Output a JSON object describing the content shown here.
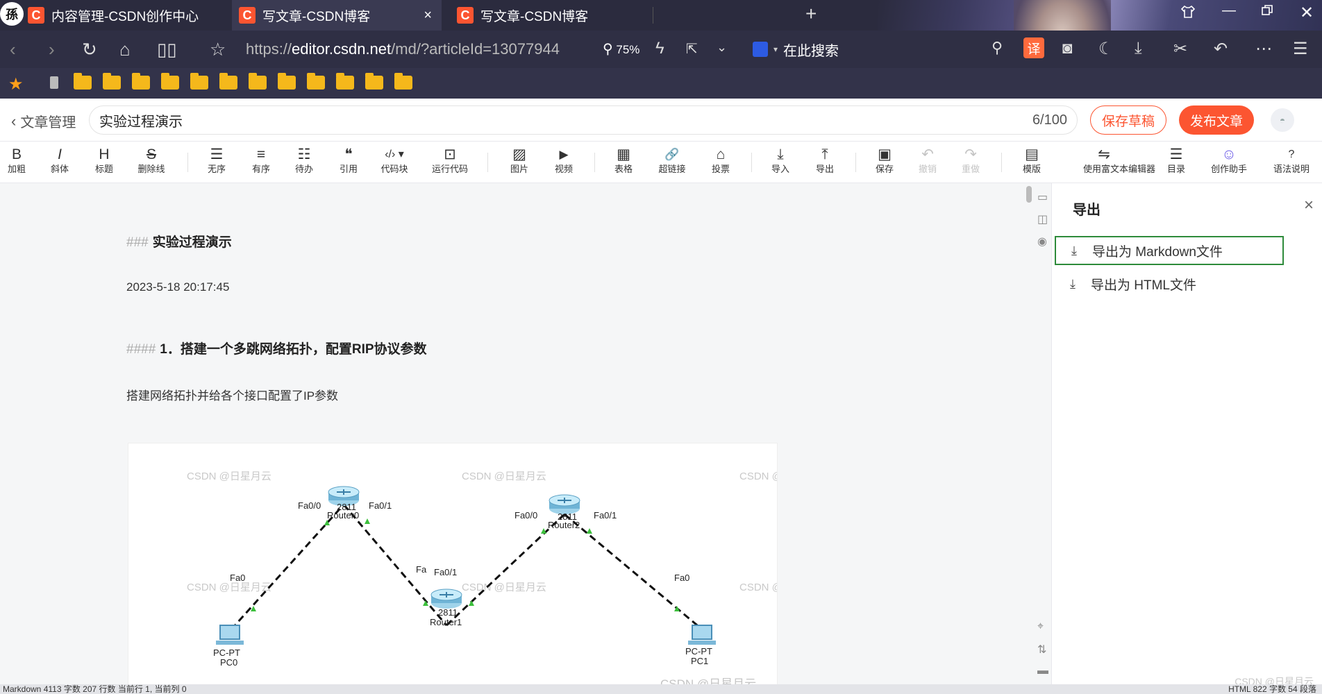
{
  "browser": {
    "app_logo": "孫",
    "tabs": [
      {
        "title": "内容管理-CSDN创作中心",
        "favicon": "C"
      },
      {
        "title": "写文章-CSDN博客",
        "favicon": "C",
        "close": "×"
      },
      {
        "title": "写文章-CSDN博客",
        "favicon": "C"
      }
    ],
    "url_prefix": "https://",
    "url_host": "editor.csdn.net",
    "url_path": "/md/?articleId=13077944",
    "zoom": "75%",
    "search_placeholder": "在此搜索",
    "translate_label": "译"
  },
  "editor": {
    "back_label": "文章管理",
    "title_value": "实验过程演示",
    "title_count": "6/100",
    "save_draft": "保存草稿",
    "publish": "发布文章"
  },
  "toolbar": [
    {
      "icon": "B",
      "label": "加粗"
    },
    {
      "icon": "I",
      "label": "斜体"
    },
    {
      "icon": "H",
      "label": "标题"
    },
    {
      "icon": "S",
      "label": "删除线"
    },
    {
      "icon": "☰",
      "label": "无序"
    },
    {
      "icon": "≡",
      "label": "有序"
    },
    {
      "icon": "☷",
      "label": "待办"
    },
    {
      "icon": "❝",
      "label": "引用"
    },
    {
      "icon": "‹/› ▾",
      "label": "代码块"
    },
    {
      "icon": "⊡",
      "label": "运行代码"
    },
    {
      "icon": "▨",
      "label": "图片"
    },
    {
      "icon": "▶",
      "label": "视频"
    },
    {
      "icon": "▦",
      "label": "表格"
    },
    {
      "icon": "🔗",
      "label": "超链接"
    },
    {
      "icon": "⌂",
      "label": "投票"
    },
    {
      "icon": "⤓",
      "label": "导入"
    },
    {
      "icon": "⤒",
      "label": "导出"
    },
    {
      "icon": "▣",
      "label": "保存"
    },
    {
      "icon": "↶",
      "label": "撤销"
    },
    {
      "icon": "↷",
      "label": "重做"
    },
    {
      "icon": "▤",
      "label": "模版"
    },
    {
      "icon": "⇋",
      "label": "使用富文本编辑器"
    },
    {
      "icon": "☰",
      "label": "目录"
    },
    {
      "icon": "☺",
      "label": "创作助手"
    },
    {
      "icon": "?",
      "label": "语法说明"
    }
  ],
  "content": {
    "h3_mark": "###",
    "h3_text": "实验过程演示",
    "date": "2023-5-18 20:17:45",
    "h4_mark": "####",
    "h4_text": "1．搭建一个多跳网络拓扑，配置RIP协议参数",
    "paragraph": "搭建网络拓扑并给各个接口配置了IP参数",
    "topology": {
      "watermark": "CSDN @日星月云",
      "watermark_cut": "CSDN @",
      "router0": {
        "model": "2811",
        "name": "Router0",
        "left_port": "Fa0/0",
        "right_port": "Fa0/1"
      },
      "router1": {
        "model": "2811",
        "name": "Router1",
        "left_port": "Fa",
        "right_port": "Fa0/1"
      },
      "router2": {
        "model": "2811",
        "name": "Router2",
        "left_port": "Fa0/0",
        "right_port": "Fa0/1"
      },
      "pc0": {
        "type": "PC-PT",
        "name": "PC0",
        "port": "Fa0"
      },
      "pc1": {
        "type": "PC-PT",
        "name": "PC1",
        "port": "Fa0"
      }
    }
  },
  "side_panel": {
    "title": "导出",
    "close": "×",
    "items": [
      "导出为 Markdown文件",
      "导出为 HTML文件"
    ]
  },
  "status": {
    "left": "Markdown  4113 字数  207 行数  当前行 1, 当前列 0",
    "right": "HTML  822 字数  54 段落"
  },
  "watermark_bottom": "CSDN @日星月云",
  "colors": {
    "brand": "#fc5531",
    "focus": "#2e8b3b",
    "folder": "#f5b81b"
  }
}
